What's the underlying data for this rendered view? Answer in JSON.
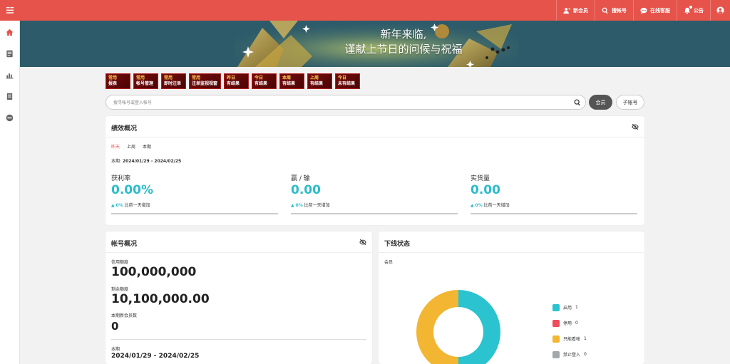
{
  "topbar": {
    "items": [
      {
        "label": "新会员",
        "icon": "add-user-icon"
      },
      {
        "label": "搜帐号",
        "icon": "search-icon"
      },
      {
        "label": "在线客服",
        "icon": "chat-icon"
      },
      {
        "label": "公告",
        "icon": "bell-icon"
      }
    ],
    "accent": "#e5534b"
  },
  "sidebar": {
    "icons": [
      "home-icon",
      "report-icon",
      "chart-icon",
      "document-icon",
      "minus-circle-icon"
    ]
  },
  "banner": {
    "line1": "新年来临,",
    "line2": "谨献上节日的问候与祝福"
  },
  "quick_buttons": [
    {
      "top": "常用",
      "bottom": "报表"
    },
    {
      "top": "常用",
      "bottom": "帐号管理"
    },
    {
      "top": "常用",
      "bottom": "即时注单"
    },
    {
      "top": "常用",
      "bottom": "注单监视视窗"
    },
    {
      "top": "昨日",
      "bottom": "有结果"
    },
    {
      "top": "今日",
      "bottom": "有结果"
    },
    {
      "top": "本周",
      "bottom": "有结果"
    },
    {
      "top": "上周",
      "bottom": "有结果"
    },
    {
      "top": "今日",
      "bottom": "未有结果"
    }
  ],
  "search": {
    "placeholder": "搜寻帐号或登入帐号",
    "member_label": "会员",
    "sub_label": "子帐号"
  },
  "performance": {
    "title": "绩效概况",
    "tabs": [
      "昨天",
      "上周",
      "本期"
    ],
    "period_label": "本期:",
    "period_range": "2024/01/29 - 2024/02/25",
    "metrics": [
      {
        "label": "获利率",
        "value": "0.00%",
        "change": "0%",
        "change_text": "比前一天增加"
      },
      {
        "label": "赢 / 输",
        "value": "0.00",
        "change": "0%",
        "change_text": "比前一天增加"
      },
      {
        "label": "实货量",
        "value": "0.00",
        "change": "0%",
        "change_text": "比前一天增加"
      }
    ]
  },
  "account": {
    "title": "帐号概况",
    "credit_label": "信用额度",
    "credit_value": "100,000,000",
    "balance_label": "剩余额度",
    "balance_value": "10,100,000.00",
    "new_members_label": "本期新会员数",
    "new_members_value": "0",
    "period_label": "本期",
    "period_range": "2024/01/29 - 2024/02/25"
  },
  "downline": {
    "title": "下线状态",
    "sub_label": "会员",
    "legend": [
      {
        "label": "启用",
        "count": "1",
        "color": "#2bc3cf"
      },
      {
        "label": "停用",
        "count": "0",
        "color": "#ef4d5c"
      },
      {
        "label": "只能看帐",
        "count": "1",
        "color": "#f2b632"
      },
      {
        "label": "禁止登入",
        "count": "0",
        "color": "#a3a8ad"
      }
    ],
    "donut_values": [
      1,
      0,
      1,
      0
    ]
  }
}
